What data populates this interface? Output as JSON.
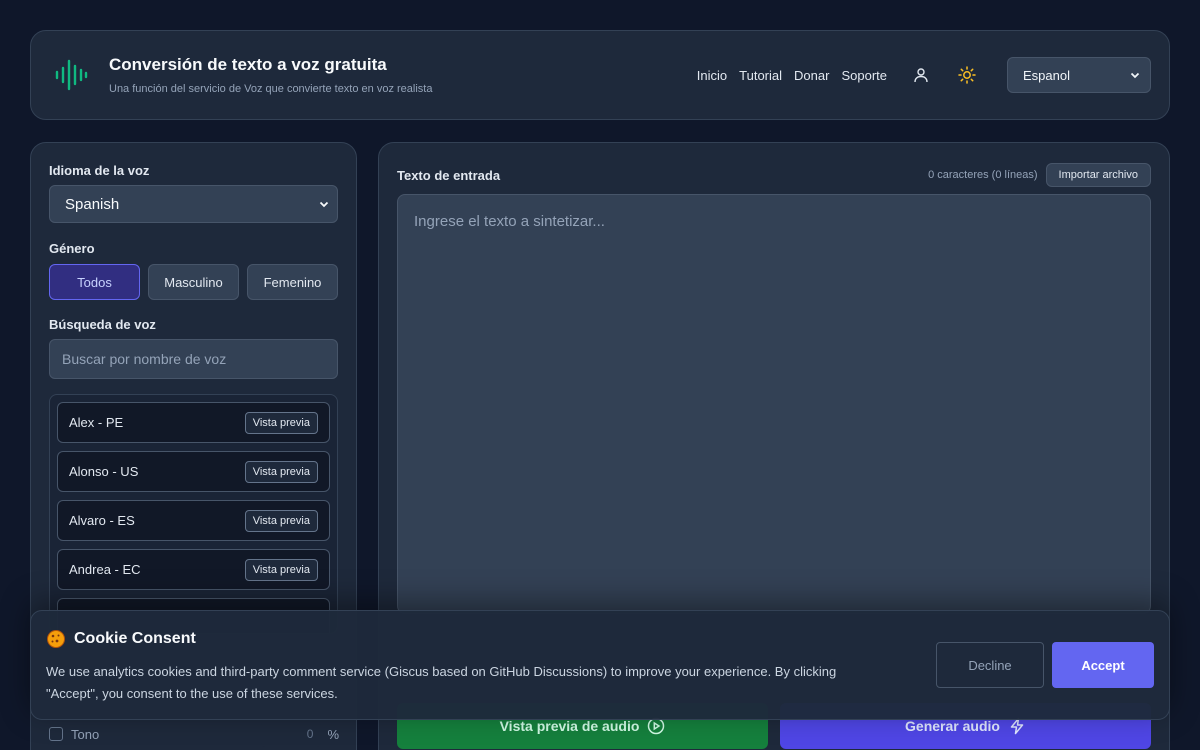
{
  "header": {
    "title": "Conversión de texto a voz gratuita",
    "subtitle": "Una función del servicio de Voz que convierte texto en voz realista",
    "nav": [
      "Inicio",
      "Tutorial",
      "Donar",
      "Soporte"
    ],
    "language_selected": "Espanol",
    "logo_color": "#10b981"
  },
  "left": {
    "voice_language_label": "Idioma de la voz",
    "voice_language_value": "Spanish",
    "gender_label": "Género",
    "gender_options": [
      "Todos",
      "Masculino",
      "Femenino"
    ],
    "gender_selected": "Todos",
    "search_label": "Búsqueda de voz",
    "search_placeholder": "Buscar por nombre de voz",
    "voices": [
      {
        "name": "Alex - PE",
        "preview": "Vista previa"
      },
      {
        "name": "Alonso - US",
        "preview": "Vista previa"
      },
      {
        "name": "Alvaro - ES",
        "preview": "Vista previa"
      },
      {
        "name": "Andrea - EC",
        "preview": "Vista previa"
      }
    ],
    "pitch_label": "Tono",
    "pitch_value": "0",
    "pitch_unit": "%"
  },
  "right": {
    "input_label": "Texto de entrada",
    "char_count": "0 caracteres (0 líneas)",
    "import_label": "Importar archivo",
    "text_placeholder": "Ingrese el texto a sintetizar...",
    "preview_audio_label": "Vista previa de audio",
    "generate_audio_label": "Generar audio"
  },
  "cookie": {
    "title": "Cookie Consent",
    "text": "We use analytics cookies and third-party comment service (Giscus based on GitHub Discussions) to improve your experience. By clicking \"Accept\", you consent to the use of these services.",
    "decline_label": "Decline",
    "accept_label": "Accept"
  },
  "colors": {
    "accent": "#6366f1",
    "green": "#15803d",
    "background": "#0f172a"
  }
}
